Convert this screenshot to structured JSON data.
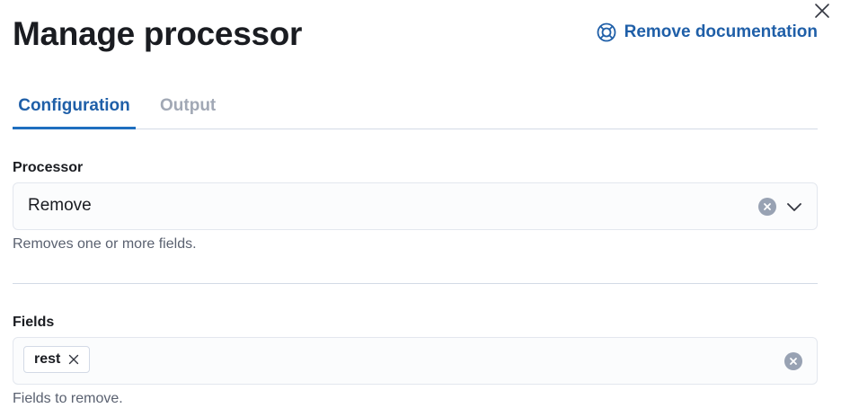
{
  "flyout": {
    "title": "Manage processor",
    "doc_link_label": "Remove documentation"
  },
  "tabs": [
    {
      "label": "Configuration",
      "selected": true
    },
    {
      "label": "Output",
      "selected": false
    }
  ],
  "processor": {
    "label": "Processor",
    "value": "Remove",
    "help": "Removes one or more fields."
  },
  "fields": {
    "label": "Fields",
    "pills": [
      "rest"
    ],
    "help": "Fields to remove."
  },
  "icons": {
    "close": "close-icon",
    "doc_link": "lifebuoy-icon",
    "clear": "clear-circle-icon",
    "dropdown": "chevron-down-icon",
    "pill_remove": "cross-icon"
  },
  "colors": {
    "accent": "#1f5fa8",
    "tab_underline": "#1f6fbf",
    "inactive_tab": "#a1a8b5",
    "text": "#1a1c21",
    "muted_text": "#5a6170",
    "border": "#d3dae6"
  }
}
